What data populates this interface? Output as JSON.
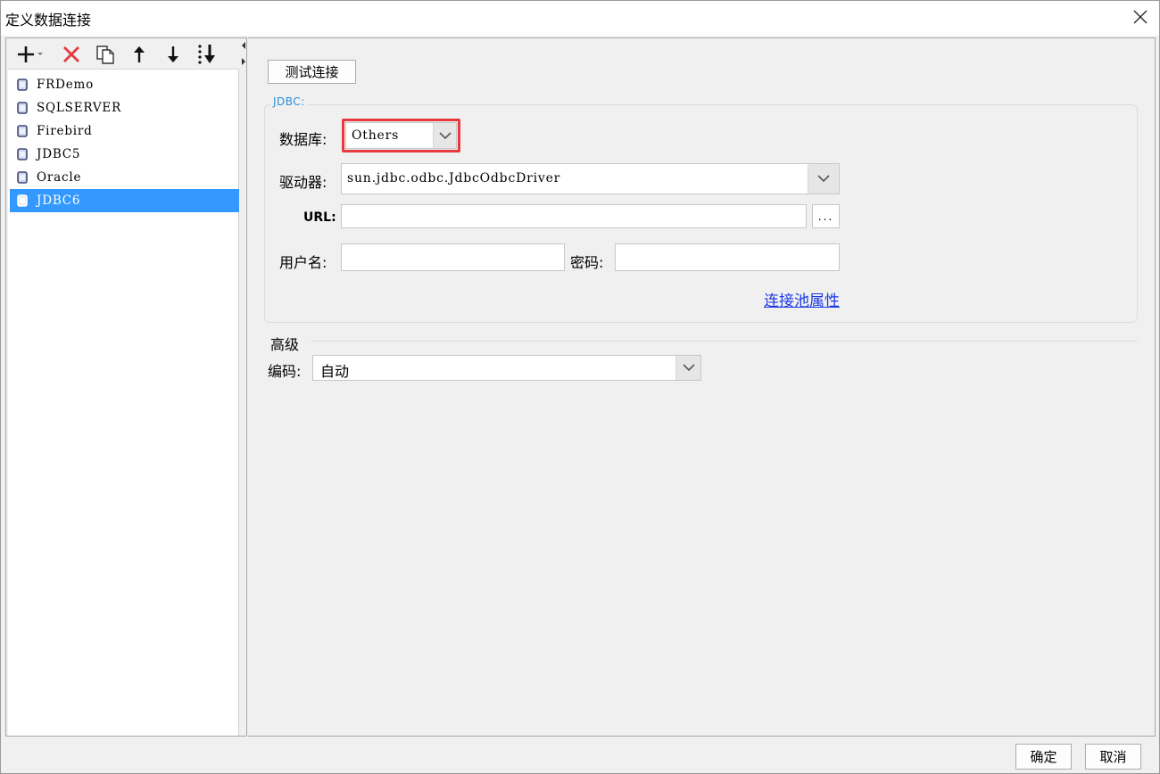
{
  "window": {
    "title": "定义数据连接",
    "close_icon": "close-icon"
  },
  "toolbar": {
    "icons": [
      "add-icon",
      "delete-icon",
      "copy-icon",
      "move-up-icon",
      "move-down-icon",
      "sort-icon"
    ],
    "delete_color": "#e8393f"
  },
  "connections": {
    "items": [
      {
        "label": "FRDemo",
        "selected": false
      },
      {
        "label": "SQLSERVER",
        "selected": false
      },
      {
        "label": "Firebird",
        "selected": false
      },
      {
        "label": "JDBC5",
        "selected": false
      },
      {
        "label": "Oracle",
        "selected": false
      },
      {
        "label": "JDBC6",
        "selected": true
      }
    ],
    "selection_color": "#3399ff"
  },
  "form": {
    "test_button": "测试连接",
    "group_legend": "JDBC:",
    "database_label": "数据库:",
    "database_value": "Others",
    "driver_label": "驱动器:",
    "driver_value": "sun.jdbc.odbc.JdbcOdbcDriver",
    "url_label": "URL:",
    "url_value": "",
    "url_browse": "...",
    "username_label": "用户名:",
    "username_value": "",
    "password_label": "密码:",
    "password_value": "",
    "pool_link": "连接池属性",
    "link_color": "#1a39e6",
    "highlight_color": "#e8393f"
  },
  "advanced": {
    "title": "高级",
    "encoding_label": "编码:",
    "encoding_value": "自动"
  },
  "footer": {
    "ok": "确定",
    "cancel": "取消"
  }
}
